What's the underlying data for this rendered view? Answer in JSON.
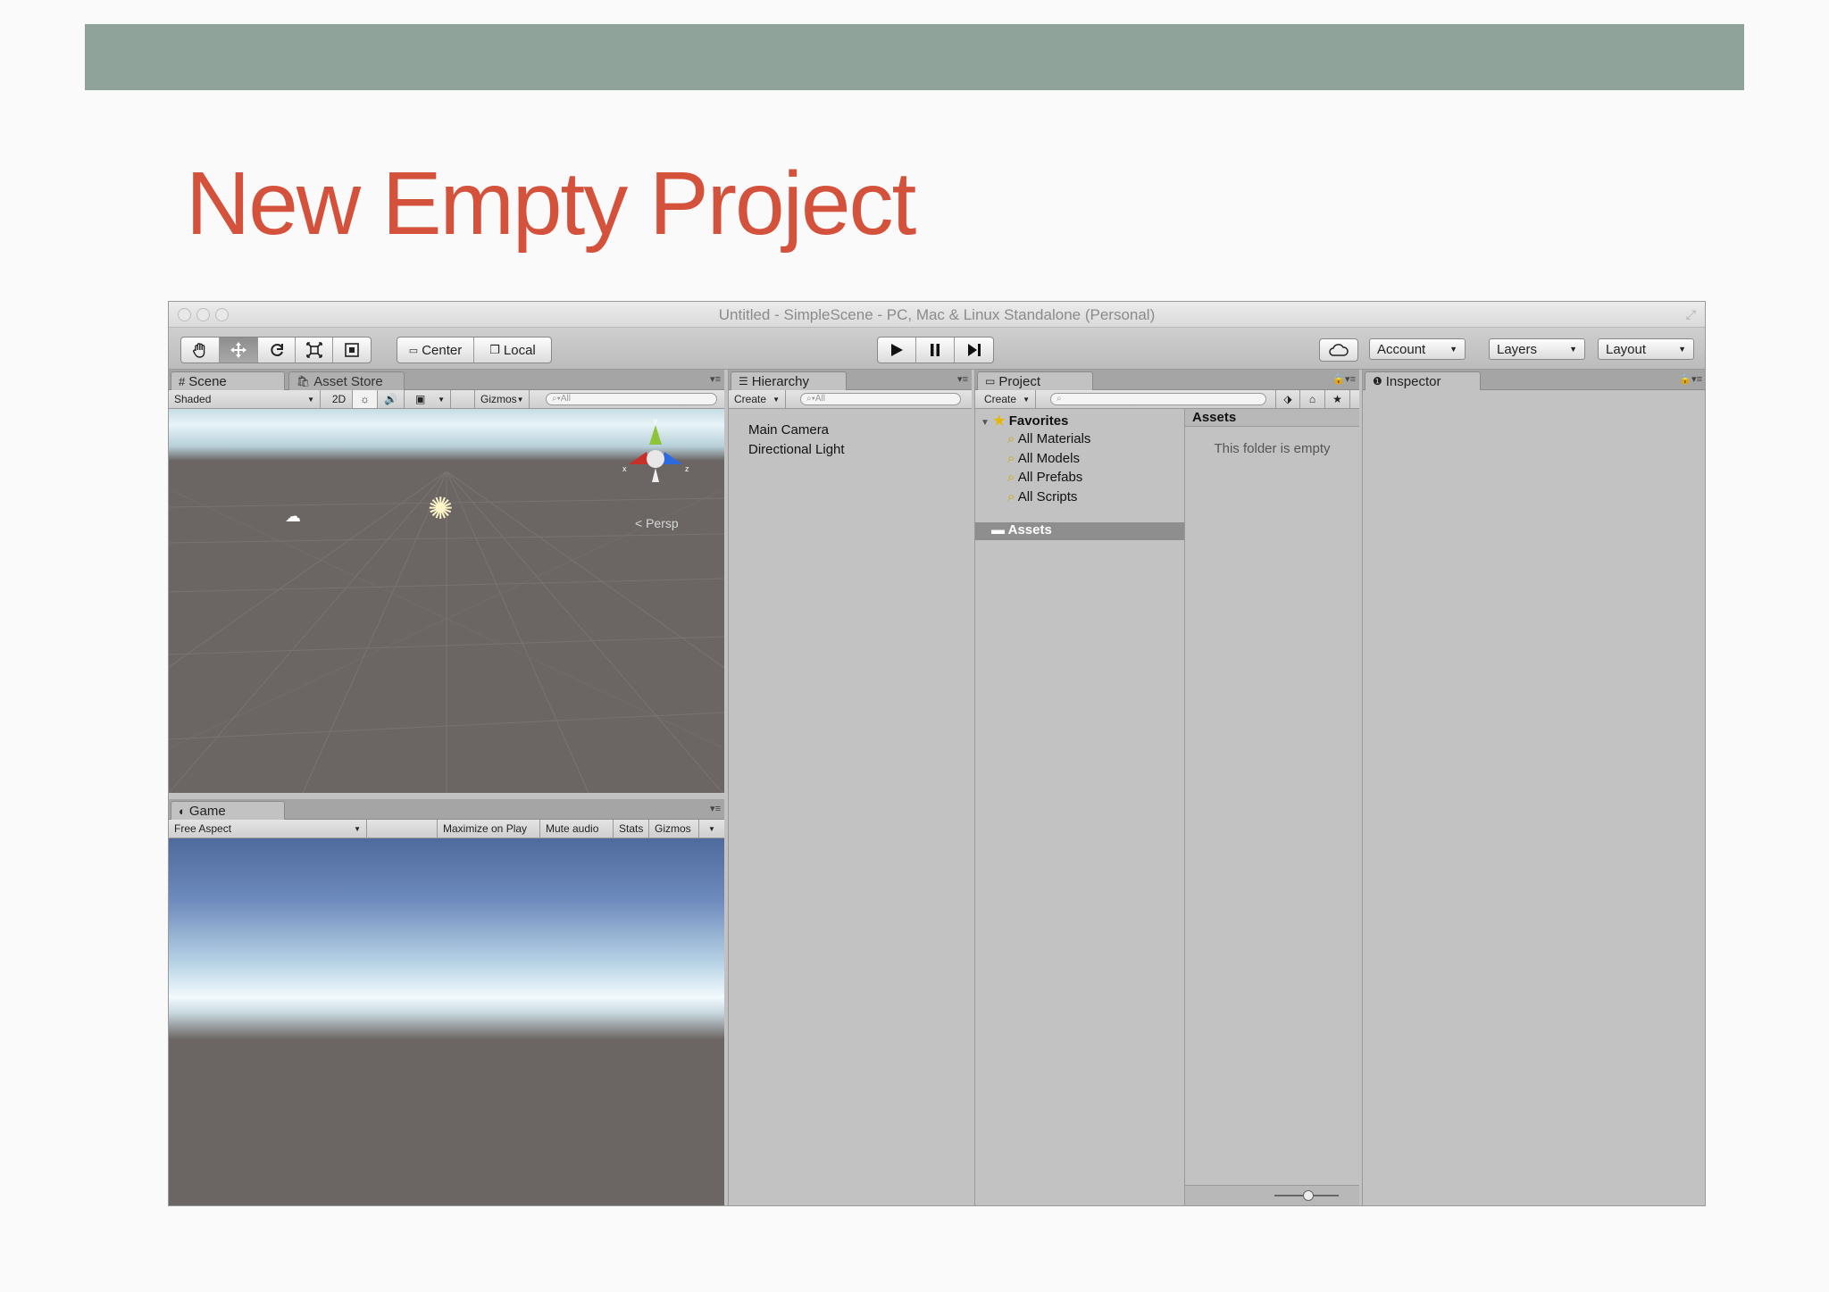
{
  "slide": {
    "title": "New Empty Project"
  },
  "window": {
    "title": "Untitled - SimpleScene - PC, Mac & Linux Standalone (Personal)"
  },
  "toolbar": {
    "pivot_center": "Center",
    "pivot_local": "Local",
    "account": "Account",
    "layers": "Layers",
    "layout": "Layout"
  },
  "scene": {
    "tab": "Scene",
    "tab_asset_store": "Asset Store",
    "shading": "Shaded",
    "mode_2d": "2D",
    "gizmos": "Gizmos",
    "search_placeholder": "All",
    "persp_label": "Persp",
    "axis_x": "x",
    "axis_y": "y",
    "axis_z": "z"
  },
  "game": {
    "tab": "Game",
    "aspect": "Free Aspect",
    "maximize": "Maximize on Play",
    "mute": "Mute audio",
    "stats": "Stats",
    "gizmos": "Gizmos"
  },
  "hierarchy": {
    "tab": "Hierarchy",
    "create": "Create",
    "search_placeholder": "All",
    "items": [
      "Main Camera",
      "Directional Light"
    ]
  },
  "project": {
    "tab": "Project",
    "create": "Create",
    "favorites": "Favorites",
    "favorite_items": [
      "All Materials",
      "All Models",
      "All Prefabs",
      "All Scripts"
    ],
    "assets_folder": "Assets",
    "assets_header": "Assets",
    "empty_message": "This folder is empty"
  },
  "inspector": {
    "tab": "Inspector"
  },
  "colors": {
    "accent_title": "#d4523c",
    "banner": "#8fa39a",
    "panel_bg": "#c2c2c2",
    "selection": "#8e8e8e"
  }
}
